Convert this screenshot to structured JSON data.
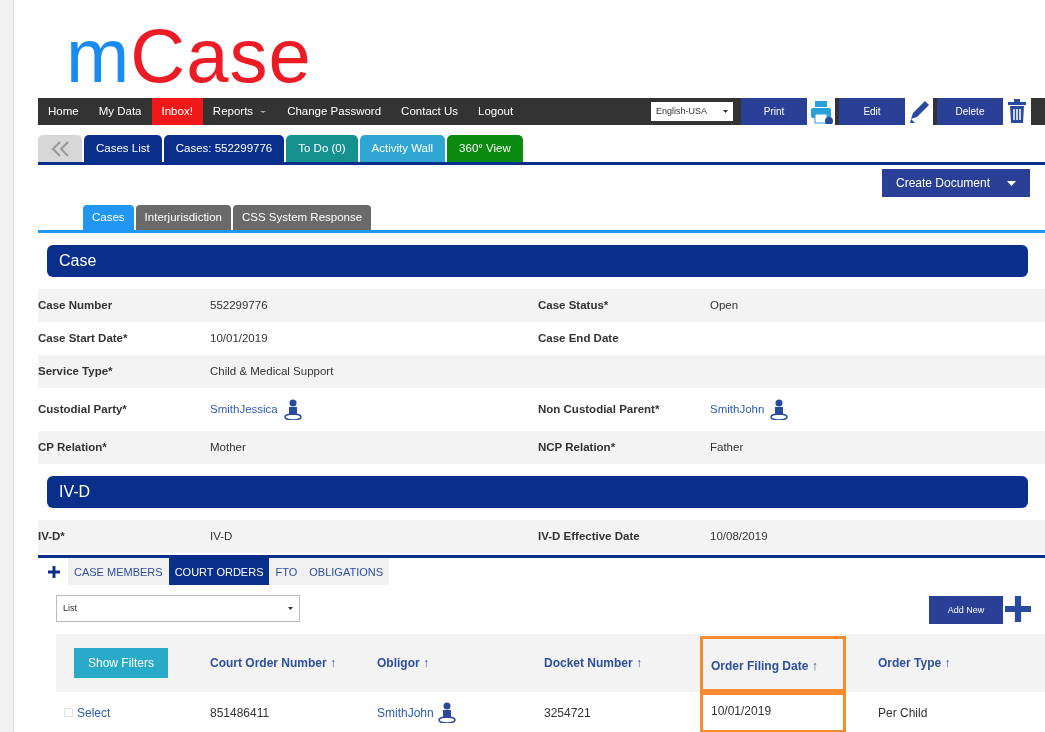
{
  "logo": {
    "parts": [
      {
        "text": "m",
        "color": "#1a8cf0"
      },
      {
        "text": "Case",
        "color": "#ec1c24"
      }
    ]
  },
  "nav": {
    "items": [
      {
        "label": "Home",
        "highlighted": false,
        "dropdown": false
      },
      {
        "label": "My Data",
        "highlighted": false,
        "dropdown": false
      },
      {
        "label": "Inbox!",
        "highlighted": true,
        "dropdown": false
      },
      {
        "label": "Reports",
        "highlighted": false,
        "dropdown": true
      },
      {
        "label": "Change Password",
        "highlighted": false,
        "dropdown": false
      },
      {
        "label": "Contact Us",
        "highlighted": false,
        "dropdown": false
      },
      {
        "label": "Logout",
        "highlighted": false,
        "dropdown": false
      }
    ],
    "language": "English-USA",
    "actions": [
      {
        "label": "Print",
        "kind": "print"
      },
      {
        "label": "Edit",
        "kind": "edit"
      },
      {
        "label": "Delete",
        "kind": "delete"
      }
    ]
  },
  "top_tabs": [
    {
      "label": "Cases List",
      "color": "#0a2f8a"
    },
    {
      "label": "Cases: 552299776",
      "color": "#0a2f8a"
    },
    {
      "label": "To Do (0)",
      "color": "#17918f"
    },
    {
      "label": "Activity Wall",
      "color": "#2fa7d2"
    },
    {
      "label": "360° View",
      "color": "#0b8a10"
    }
  ],
  "create_document": "Create Document",
  "sub_tabs": [
    {
      "label": "Cases",
      "selected": true
    },
    {
      "label": "Interjurisdiction",
      "selected": false
    },
    {
      "label": "CSS System Response",
      "selected": false
    }
  ],
  "sections": [
    {
      "title": "Case",
      "rows": [
        [
          {
            "label": "Case Number",
            "value": "552299776",
            "kind": "text"
          },
          {
            "label": "Case Status*",
            "value": "Open",
            "kind": "text"
          }
        ],
        [
          {
            "label": "Case Start Date*",
            "value": "10/01/2019",
            "kind": "text"
          },
          {
            "label": "Case End Date",
            "kind": "text"
          }
        ],
        [
          {
            "label": "Service Type*",
            "value": "Child & Medical Support",
            "kind": "text"
          }
        ],
        [
          {
            "label": "Custodial Party*",
            "value": "SmithJessica",
            "kind": "person"
          },
          {
            "label": "Non Custodial Parent*",
            "value": "SmithJohn",
            "kind": "person"
          }
        ],
        [
          {
            "label": "CP Relation*",
            "value": "Mother",
            "kind": "text"
          },
          {
            "label": "NCP Relation*",
            "value": "Father",
            "kind": "text"
          }
        ]
      ]
    },
    {
      "title": "IV-D",
      "rows": [
        [
          {
            "label": "IV-D*",
            "value": "IV-D",
            "kind": "text"
          },
          {
            "label": "IV-D Effective Date",
            "value": "10/08/2019",
            "kind": "text"
          }
        ]
      ]
    }
  ],
  "detail_tabs": [
    {
      "label": "CASE MEMBERS",
      "selected": false
    },
    {
      "label": "COURT ORDERS",
      "selected": true
    },
    {
      "label": "FTO",
      "selected": false
    },
    {
      "label": "OBLIGATIONS",
      "selected": false
    }
  ],
  "view_select": "List",
  "add_new": "Add New",
  "show_filters": "Show Filters",
  "table": {
    "columns": [
      {
        "label": "Court Order Number ↑",
        "highlighted": false
      },
      {
        "label": "Obligor ↑",
        "highlighted": false
      },
      {
        "label": "Docket Number ↑",
        "highlighted": false
      },
      {
        "label": "Order Filing Date ↑",
        "highlighted": true
      },
      {
        "label": "Order Type ↑",
        "highlighted": false
      }
    ],
    "rows": [
      {
        "select": "Select",
        "checked": false,
        "cells": [
          {
            "text": "851486411",
            "kind": "text"
          },
          {
            "text": "SmithJohn",
            "kind": "person"
          },
          {
            "text": "3254721",
            "kind": "text"
          },
          {
            "text": "10/01/2019",
            "kind": "text"
          },
          {
            "text": "Per Child",
            "kind": "text"
          }
        ]
      }
    ]
  }
}
